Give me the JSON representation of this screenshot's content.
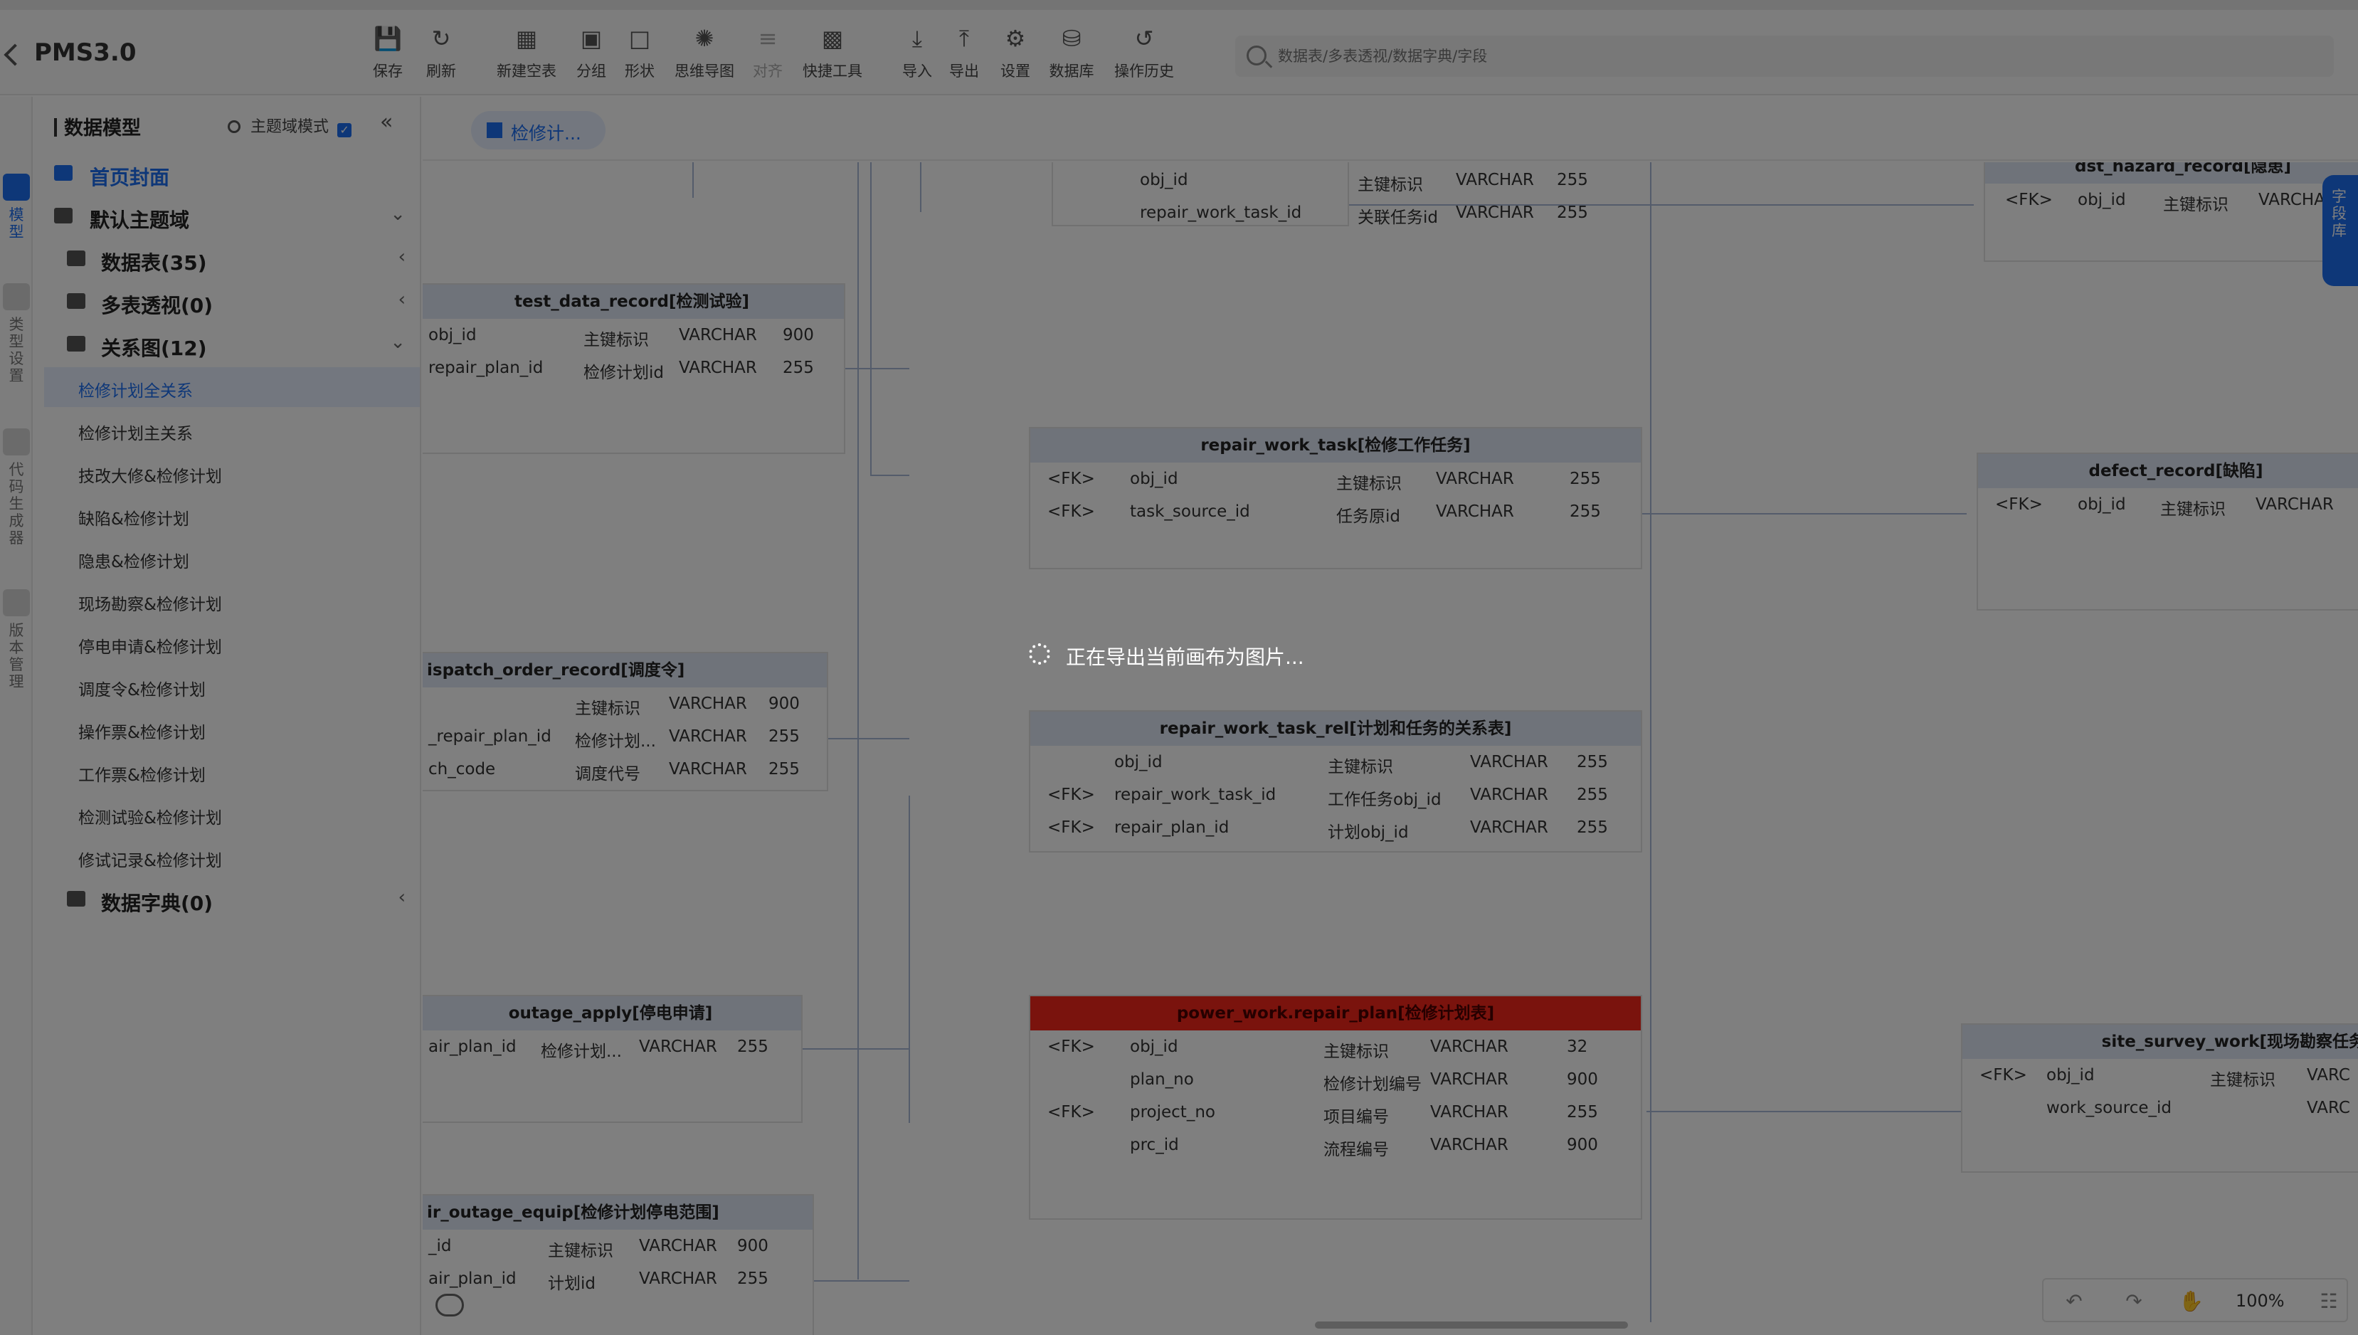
{
  "app": {
    "title": "PMS3.0"
  },
  "toolbar": {
    "save": "保存",
    "refresh": "刷新",
    "new_table": "新建空表",
    "group": "分组",
    "shape": "形状",
    "mindmap": "思维导图",
    "align": "对齐",
    "quick_tools": "快捷工具",
    "import": "导入",
    "export": "导出",
    "settings": "设置",
    "database": "数据库",
    "history": "操作历史"
  },
  "search": {
    "placeholder": "数据表/多表透视/数据字典/字段"
  },
  "rail": {
    "model": "模型",
    "type_settings": "类型设置",
    "code_generator": "代码生成器",
    "version_manage": "版本管理"
  },
  "right_panel": {
    "label": "字段库"
  },
  "sidebar": {
    "title": "数据模型",
    "mode_label": "主题域模式",
    "cover": "首页封面",
    "default_domain": "默认主题域",
    "tables": "数据表(35)",
    "pivot": "多表透视(0)",
    "diagrams": "关系图(12)",
    "dict": "数据字典(0)",
    "diagram_items": [
      "检修计划全关系",
      "检修计划主关系",
      "技改大修&检修计划",
      "缺陷&检修计划",
      "隐患&检修计划",
      "现场勘察&检修计划",
      "停电申请&检修计划",
      "调度令&检修计划",
      "操作票&检修计划",
      "工作票&检修计划",
      "检测试验&检修计划",
      "修试记录&检修计划"
    ]
  },
  "tab": {
    "label": "检修计..."
  },
  "tables": {
    "top_partial": {
      "rows": [
        [
          "",
          "obj_id",
          "主键标识",
          "VARCHAR",
          "255"
        ],
        [
          "",
          "repair_work_task_id",
          "关联任务id",
          "VARCHAR",
          "255"
        ]
      ]
    },
    "hazard": {
      "title": "dst_hazard_record[隐患]",
      "rows": [
        [
          "<FK>",
          "obj_id",
          "主键标识",
          "VARCHAR"
        ]
      ]
    },
    "test_data": {
      "title": "test_data_record[检测试验]",
      "rows": [
        [
          "obj_id",
          "主键标识",
          "VARCHAR",
          "900"
        ],
        [
          "repair_plan_id",
          "检修计划id",
          "VARCHAR",
          "255"
        ]
      ]
    },
    "repair_work_task": {
      "title": "repair_work_task[检修工作任务]",
      "rows": [
        [
          "<FK>",
          "obj_id",
          "主键标识",
          "VARCHAR",
          "255"
        ],
        [
          "<FK>",
          "task_source_id",
          "任务原id",
          "VARCHAR",
          "255"
        ]
      ]
    },
    "defect": {
      "title": "defect_record[缺陷]",
      "rows": [
        [
          "<FK>",
          "obj_id",
          "主键标识",
          "VARCHAR"
        ]
      ]
    },
    "dispatch": {
      "title": "ispatch_order_record[调度令]",
      "rows": [
        [
          "",
          "主键标识",
          "VARCHAR",
          "900"
        ],
        [
          "_repair_plan_id",
          "检修计划...",
          "VARCHAR",
          "255"
        ],
        [
          "ch_code",
          "调度代号",
          "VARCHAR",
          "255"
        ]
      ]
    },
    "task_rel": {
      "title": "repair_work_task_rel[计划和任务的关系表]",
      "rows": [
        [
          "",
          "obj_id",
          "主键标识",
          "VARCHAR",
          "255"
        ],
        [
          "<FK>",
          "repair_work_task_id",
          "工作任务obj_id",
          "VARCHAR",
          "255"
        ],
        [
          "<FK>",
          "repair_plan_id",
          "计划obj_id",
          "VARCHAR",
          "255"
        ]
      ]
    },
    "outage": {
      "title": "outage_apply[停电申请]",
      "rows": [
        [
          "air_plan_id",
          "检修计划...",
          "VARCHAR",
          "255"
        ]
      ]
    },
    "repair_plan": {
      "title": "power_work.repair_plan[检修计划表]",
      "rows": [
        [
          "<FK>",
          "obj_id",
          "主键标识",
          "VARCHAR",
          "32"
        ],
        [
          "",
          "plan_no",
          "检修计划编号",
          "VARCHAR",
          "900"
        ],
        [
          "<FK>",
          "project_no",
          "项目编号",
          "VARCHAR",
          "255"
        ],
        [
          "",
          "prc_id",
          "流程编号",
          "VARCHAR",
          "900"
        ]
      ]
    },
    "site_survey": {
      "title": "site_survey_work[现场勘察任务",
      "rows": [
        [
          "<FK>",
          "obj_id",
          "主键标识",
          "VARC"
        ],
        [
          "",
          "work_source_id",
          "",
          "VARC"
        ]
      ]
    },
    "outage_equip": {
      "title": "ir_outage_equip[检修计划停电范围]",
      "rows": [
        [
          "_id",
          "主键标识",
          "VARCHAR",
          "900"
        ],
        [
          "air_plan_id",
          "计划id",
          "VARCHAR",
          "255"
        ]
      ]
    }
  },
  "bottom": {
    "zoom": "100%"
  },
  "overlay": {
    "message": "正在导出当前画布为图片..."
  }
}
